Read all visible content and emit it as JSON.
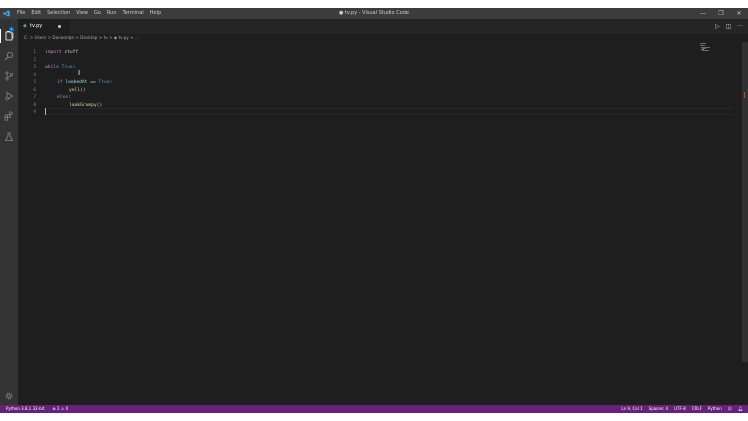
{
  "titlebar": {
    "menu": [
      "File",
      "Edit",
      "Selection",
      "View",
      "Go",
      "Run",
      "Terminal",
      "Help"
    ],
    "title": "● tv.py - Visual Studio Code",
    "controls": {
      "minimize": "—",
      "maximize": "❐",
      "close": "✕"
    }
  },
  "activity": {
    "explorer_badge": "1",
    "icons": [
      "files-icon",
      "search-icon",
      "source-control-icon",
      "run-debug-icon",
      "extensions-icon",
      "testing-icon"
    ]
  },
  "tab": {
    "name": "tv.py"
  },
  "breadcrumb": "C: > Users > Danoontje > Desktop > tv > ◆ tv.py > ...",
  "editor": {
    "line_numbers": [
      "1",
      "2",
      "3",
      "4",
      "5",
      "6",
      "7",
      "8",
      "9"
    ],
    "lines": {
      "l1_kw": "import",
      "l1_mod": " stuff",
      "l3_kw": "while",
      "l3_val": " True",
      "l5_kw": "if",
      "l5_var": " lookedAt",
      "l5_op": " == ",
      "l5_val": "True",
      "l6_fn": "yell",
      "l7_kw": "else",
      "l8_fn": "lookGrumpy"
    }
  },
  "status": {
    "interpreter": "Python 3.8.1 32-bit",
    "problems": "⊗ 2 ⚠ 0",
    "position": "Ln 9, Col 1",
    "spaces": "Spaces: 4",
    "encoding": "UTF-8",
    "eol": "CRLF",
    "language": "Python"
  },
  "colors": {
    "statusbar": "#68217a",
    "editor": "#1e1e1e",
    "keyword": "#c586c0",
    "function": "#dcdcaa"
  }
}
